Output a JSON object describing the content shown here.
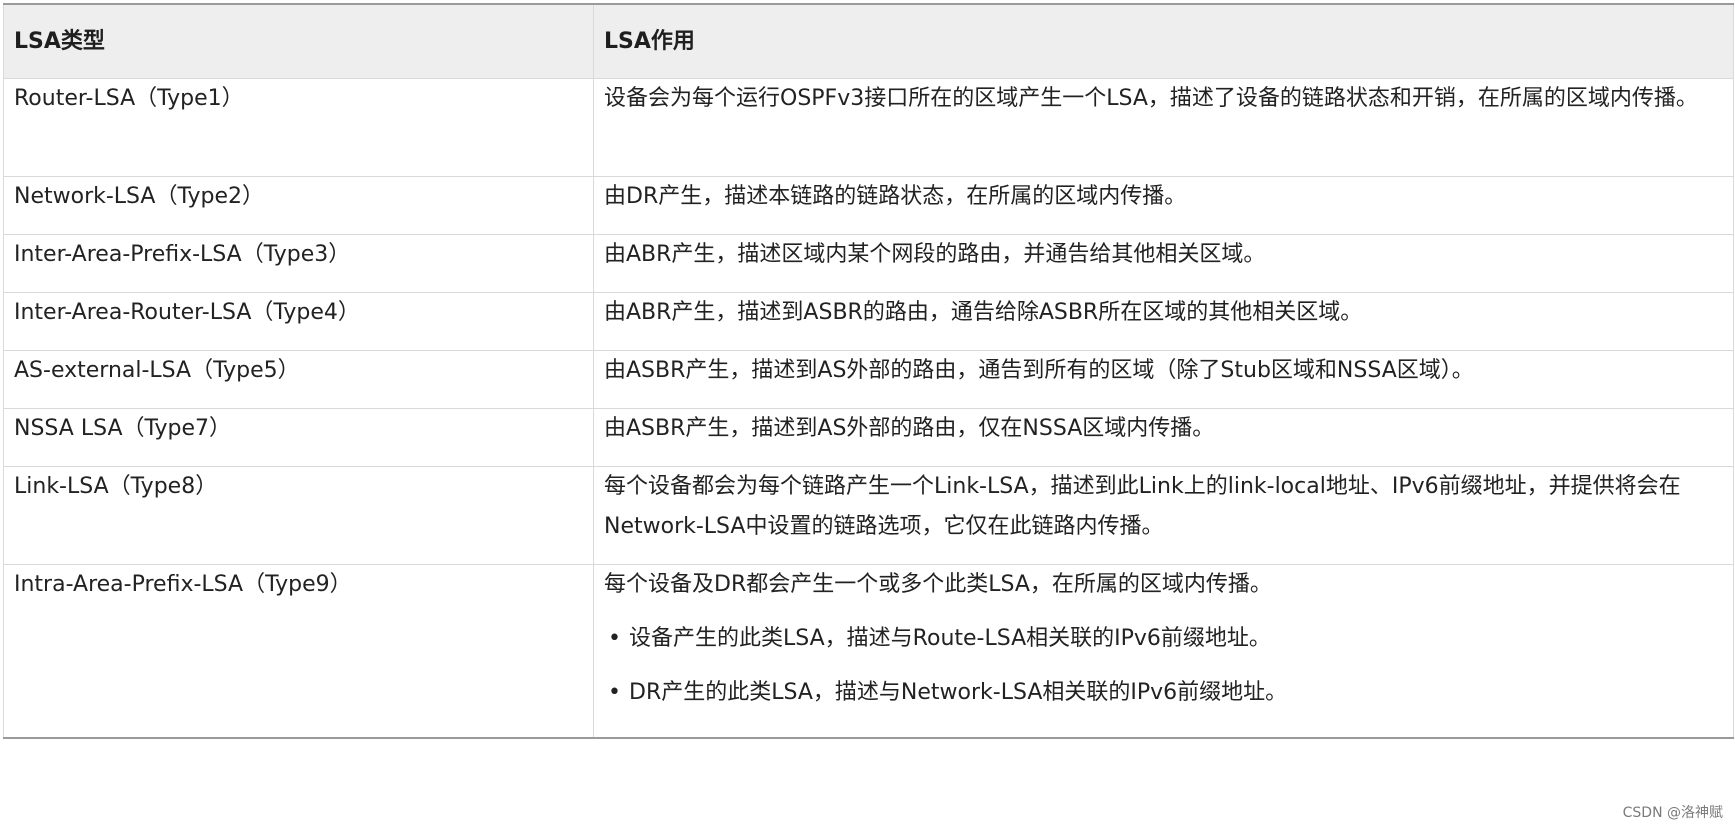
{
  "table": {
    "headers": [
      "LSA类型",
      "LSA作用"
    ],
    "rows": [
      {
        "type": "Router-LSA（Type1）",
        "desc": "设备会为每个运行OSPFv3接口所在的区域产生一个LSA，描述了设备的链路状态和开销，在所属的区域内传播。"
      },
      {
        "type": "Network-LSA（Type2）",
        "desc": "由DR产生，描述本链路的链路状态，在所属的区域内传播。"
      },
      {
        "type": "Inter-Area-Prefix-LSA（Type3）",
        "desc": "由ABR产生，描述区域内某个网段的路由，并通告给其他相关区域。"
      },
      {
        "type": "Inter-Area-Router-LSA（Type4）",
        "desc": "由ABR产生，描述到ASBR的路由，通告给除ASBR所在区域的其他相关区域。"
      },
      {
        "type": "AS-external-LSA（Type5）",
        "desc": "由ASBR产生，描述到AS外部的路由，通告到所有的区域（除了Stub区域和NSSA区域）。"
      },
      {
        "type": "NSSA LSA（Type7）",
        "desc": "由ASBR产生，描述到AS外部的路由，仅在NSSA区域内传播。"
      },
      {
        "type": "Link-LSA（Type8）",
        "desc": "每个设备都会为每个链路产生一个Link-LSA，描述到此Link上的link-local地址、IPv6前缀地址，并提供将会在Network-LSA中设置的链路选项，它仅在此链路内传播。"
      },
      {
        "type": "Intra-Area-Prefix-LSA（Type9）",
        "desc": "每个设备及DR都会产生一个或多个此类LSA，在所属的区域内传播。",
        "bullets": [
          "设备产生的此类LSA，描述与Route-LSA相关联的IPv6前缀地址。",
          "DR产生的此类LSA，描述与Network-LSA相关联的IPv6前缀地址。"
        ]
      }
    ]
  },
  "bullet_char": "•",
  "watermark": "CSDN @洛神赋"
}
